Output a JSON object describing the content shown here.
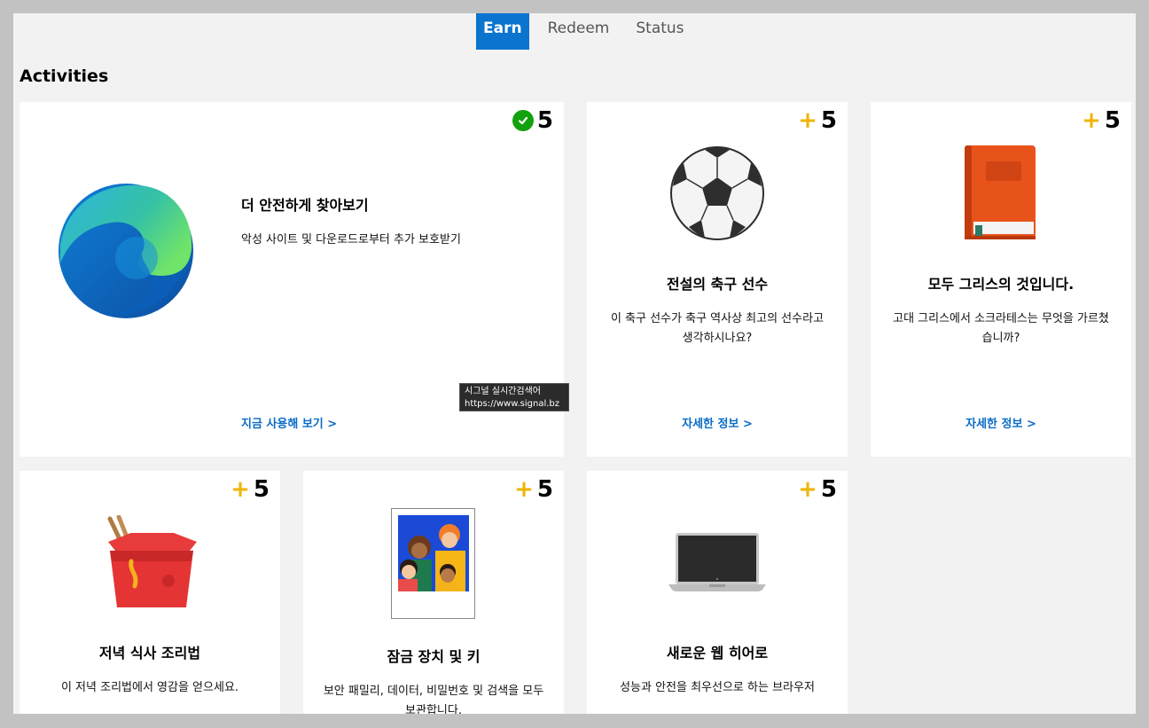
{
  "tabs": [
    {
      "label": "Earn",
      "active": true
    },
    {
      "label": "Redeem",
      "active": false
    },
    {
      "label": "Status",
      "active": false
    }
  ],
  "section_title": "Activities",
  "accent_color": "#0a74cf",
  "points_color": "#f0b400",
  "cards": [
    {
      "points": "5",
      "status": "completed",
      "icon": "edge-logo",
      "title": "더 안전하게 찾아보기",
      "description": "악성 사이트 및 다운로드로부터 추가 보호받기",
      "link": "지금 사용해 보기 >"
    },
    {
      "points": "5",
      "status": "available",
      "icon": "soccer-ball",
      "title": "전설의 축구 선수",
      "description": "이 축구 선수가 축구 역사상 최고의 선수라고 생각하시나요?",
      "link": "자세한 정보 >"
    },
    {
      "points": "5",
      "status": "available",
      "icon": "book",
      "title": "모두 그리스의 것입니다.",
      "description": "고대 그리스에서 소크라테스는 무엇을 가르쳤습니까?",
      "link": "자세한 정보 >"
    },
    {
      "points": "5",
      "status": "available",
      "icon": "takeout-box",
      "title": "저녁 식사 조리법",
      "description": "이 저녁 조리법에서 영감을 얻으세요."
    },
    {
      "points": "5",
      "status": "available",
      "icon": "family-photo",
      "title": "잠금 장치 및 키",
      "description": "보안 패밀리, 데이터, 비밀번호 및 검색을 모두 보관합니다."
    },
    {
      "points": "5",
      "status": "available",
      "icon": "laptop",
      "title": "새로운 웹 히어로",
      "description": "성능과 안전을 최우선으로 하는 브라우저"
    }
  ],
  "tooltip": {
    "line1": "시그널 실시간검색어",
    "line2": "https://www.signal.bz"
  }
}
